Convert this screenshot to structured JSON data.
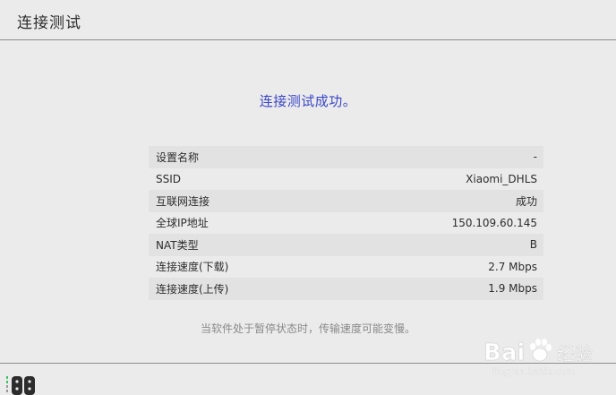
{
  "header": {
    "title": "连接测试"
  },
  "result": {
    "message": "连接测试成功。"
  },
  "info_rows": [
    {
      "label": "设置名称",
      "value": "-"
    },
    {
      "label": "SSID",
      "value": "Xiaomi_DHLS"
    },
    {
      "label": "互联网连接",
      "value": "成功"
    },
    {
      "label": "全球IP地址",
      "value": "150.109.60.145"
    },
    {
      "label": "NAT类型",
      "value": "B"
    },
    {
      "label": "连接速度(下载)",
      "value": "2.7 Mbps"
    },
    {
      "label": "连接速度(上传)",
      "value": "1.9 Mbps"
    }
  ],
  "note": "当软件处于暂停状态时，传输速度可能变慢。",
  "footer": {
    "icon": "joycon-controller-icon"
  },
  "watermark": {
    "brand": "Bai 经验",
    "url": "jingyan.baidu.com"
  }
}
